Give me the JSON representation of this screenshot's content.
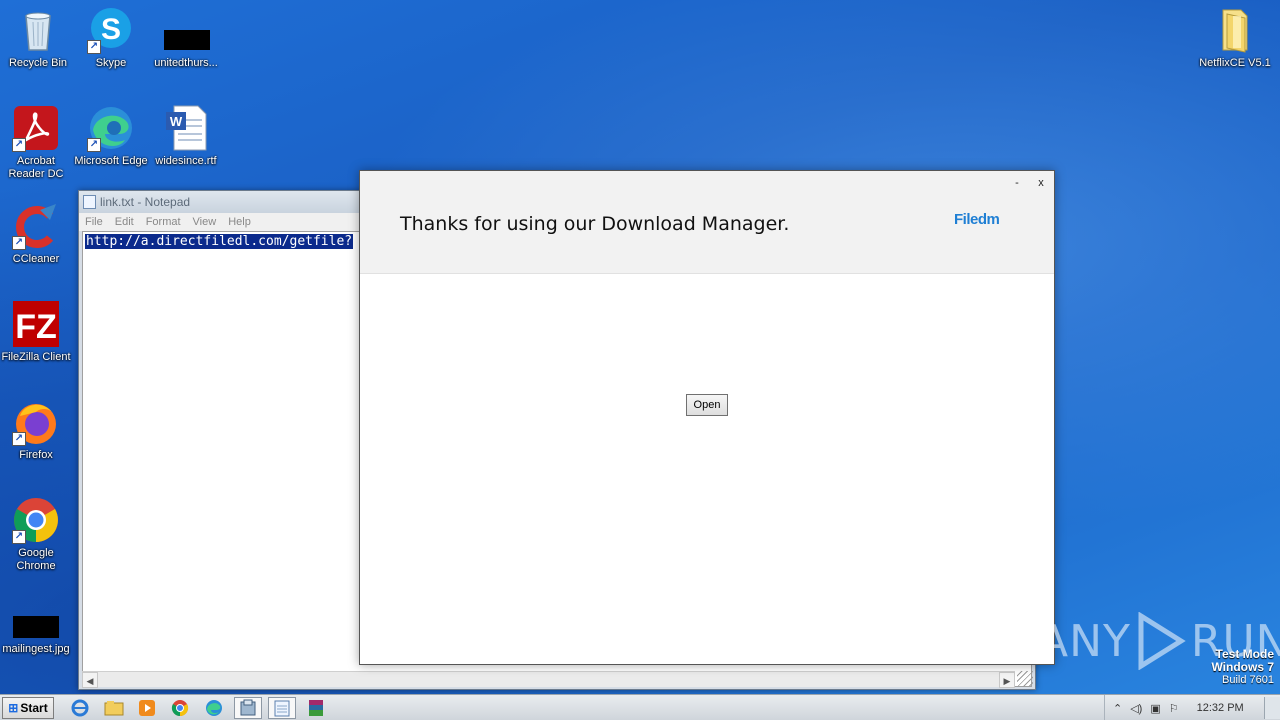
{
  "desktop": {
    "icons": [
      {
        "label": "Recycle Bin",
        "icon": "recycle-bin-icon"
      },
      {
        "label": "Skype",
        "icon": "skype-icon"
      },
      {
        "label": "unitedthurs...",
        "icon": "redacted-file-icon"
      },
      {
        "label": "NetflixCE V5.1",
        "icon": "folder-icon"
      },
      {
        "label": "Acrobat Reader DC",
        "icon": "acrobat-icon"
      },
      {
        "label": "Microsoft Edge",
        "icon": "edge-icon"
      },
      {
        "label": "widesince.rtf",
        "icon": "word-document-icon"
      },
      {
        "label": "CCleaner",
        "icon": "ccleaner-icon"
      },
      {
        "label": "FileZilla Client",
        "icon": "filezilla-icon"
      },
      {
        "label": "Firefox",
        "icon": "firefox-icon"
      },
      {
        "label": "Google Chrome",
        "icon": "chrome-icon"
      },
      {
        "label": "mailingest.jpg",
        "icon": "redacted-file-icon"
      }
    ]
  },
  "notepad": {
    "title": "link.txt - Notepad",
    "menu": [
      "File",
      "Edit",
      "Format",
      "View",
      "Help"
    ],
    "content": "http://a.directfiledl.com/getfile?"
  },
  "dialog": {
    "message": "Thanks for using our Download Manager.",
    "logo": "Filedm",
    "minimize": "-",
    "close": "x",
    "open_label": "Open"
  },
  "watermark": {
    "left": "ANY",
    "right": "RUN",
    "line1": "Test Mode",
    "line2": "Windows 7",
    "line3": "Build 7601"
  },
  "taskbar": {
    "start_label": "Start",
    "items": [
      "ie-icon",
      "explorer-icon",
      "media-player-icon",
      "chrome-icon",
      "edge-icon",
      "installer-icon",
      "notepad-icon",
      "winrar-icon"
    ],
    "clock": "12:32 PM"
  },
  "colors": {
    "desktop_blue": "#1a5fc4",
    "filedm_blue": "#1f7fd4",
    "selection": "#0b2a8c"
  }
}
